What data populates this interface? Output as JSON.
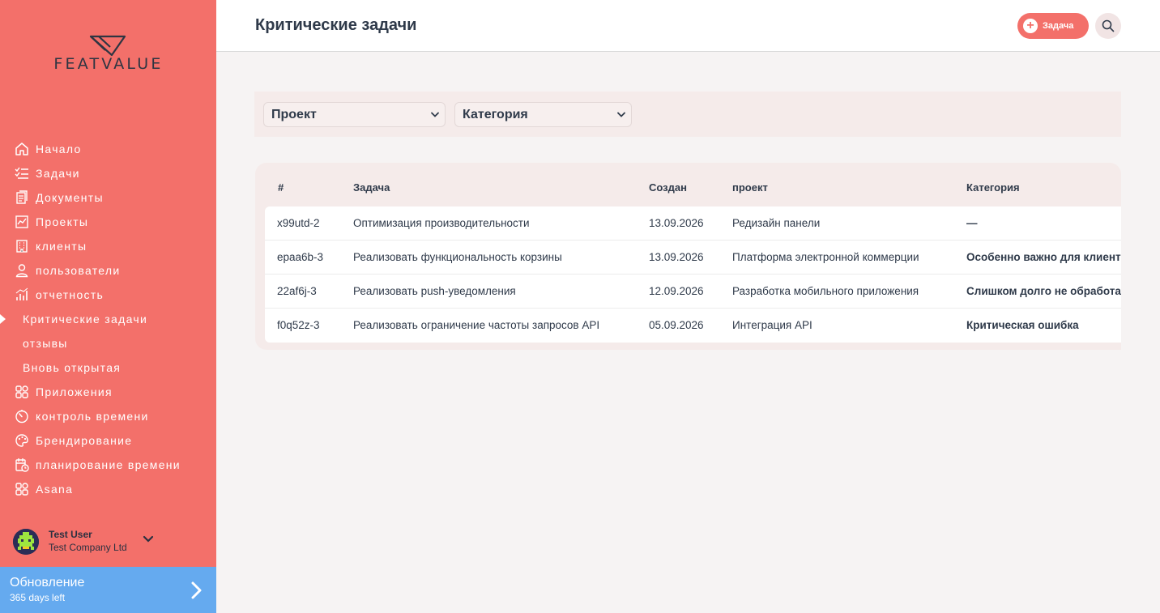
{
  "brand": {
    "name": "FEATVALUE"
  },
  "nav": {
    "items": [
      {
        "label": "Начало",
        "icon": "home-icon"
      },
      {
        "label": "Задачи",
        "icon": "tasks-icon"
      },
      {
        "label": "Документы",
        "icon": "documents-icon"
      },
      {
        "label": "Проекты",
        "icon": "projects-icon"
      },
      {
        "label": "клиенты",
        "icon": "building-icon"
      },
      {
        "label": "пользователи",
        "icon": "user-icon"
      },
      {
        "label": "отчетность",
        "icon": "chart-icon"
      },
      {
        "label": "Критические задачи",
        "active": true,
        "sub": true
      },
      {
        "label": "отзывы",
        "sub": true
      },
      {
        "label": "Вновь открытая",
        "sub": true
      },
      {
        "label": "Приложения",
        "icon": "apps-icon"
      },
      {
        "label": "контроль времени",
        "icon": "timer-icon"
      },
      {
        "label": "Брендирование",
        "icon": "palette-icon"
      },
      {
        "label": "планирование времени",
        "icon": "calendar-clock-icon"
      },
      {
        "label": "Asana",
        "icon": "apps-icon"
      }
    ]
  },
  "user": {
    "name": "Test User",
    "company": "Test Company Ltd"
  },
  "upgrade": {
    "title": "Обновление",
    "subtitle": "365 days left"
  },
  "header": {
    "title": "Критические задачи",
    "add_task_label": "Задача"
  },
  "filters": {
    "project": "Проект",
    "category": "Категория"
  },
  "table": {
    "columns": [
      "#",
      "Задача",
      "Создан",
      "проект",
      "Категория"
    ],
    "rows": [
      [
        "x99utd-2",
        "Оптимизация производительности",
        "13.09.2026",
        "Редизайн панели",
        "—"
      ],
      [
        "epaa6b-3",
        "Реализовать функциональность корзины",
        "13.09.2026",
        "Платформа электронной коммерции",
        "Особенно важно для клиента"
      ],
      [
        "22af6j-3",
        "Реализовать push-уведомления",
        "12.09.2026",
        "Разработка мобильного приложения",
        "Слишком долго не обработан"
      ],
      [
        "f0q52z-3",
        "Реализовать ограничение частоты запросов API",
        "05.09.2026",
        "Интеграция API",
        "Критическая ошибка"
      ]
    ]
  },
  "colors": {
    "accent": "#f3706a",
    "upgrade": "#65aaef",
    "text": "#2f3a4a"
  }
}
